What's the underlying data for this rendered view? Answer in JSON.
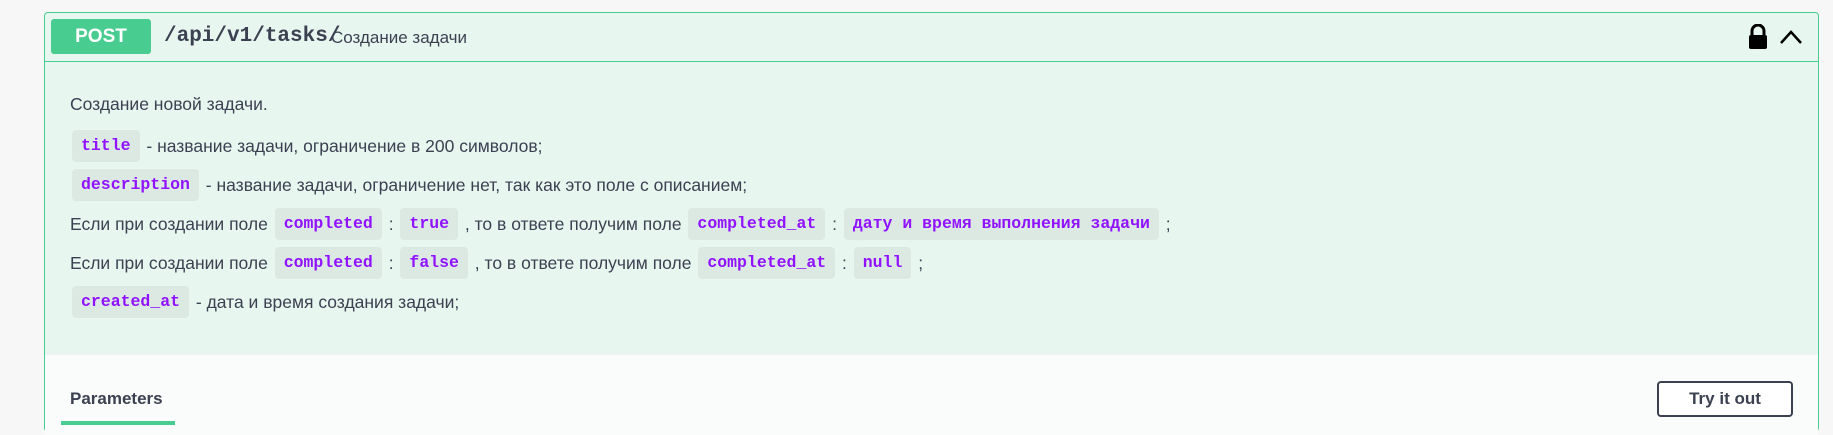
{
  "operation": {
    "method": "POST",
    "path": "/api/v1/tasks/",
    "summary": "Создание задачи"
  },
  "icons": {
    "lock": "lock-icon",
    "collapse": "chevron-up-icon"
  },
  "description": {
    "intro": "Создание новой задачи.",
    "title_line": {
      "code": "title",
      "text": " - название задачи, ограничение в 200 символов;"
    },
    "description_line": {
      "code": "description",
      "text": " - название задачи, ограничение нет, так как это поле с описанием;"
    },
    "completed_true_line": {
      "prefix": "Если при создании поле ",
      "field": "completed",
      "colon": " : ",
      "value": "true",
      "middle": " , то в ответе получим поле ",
      "result_field": "completed_at",
      "colon2": " : ",
      "result_value": "дату и время выполнения задачи",
      "suffix": " ;"
    },
    "completed_false_line": {
      "prefix": "Если при создании поле ",
      "field": "completed",
      "colon": " : ",
      "value": "false",
      "middle": " , то в ответе получим поле ",
      "result_field": "completed_at",
      "colon2": " : ",
      "result_value": "null",
      "suffix": " ;"
    },
    "created_at_line": {
      "code": "created_at",
      "text": " - дата и время создания задачи;"
    }
  },
  "parameters": {
    "tab_label": "Parameters",
    "try_button_label": "Try it out"
  },
  "colors": {
    "post_green": "#49cc90",
    "block_background": "#e8f6f0",
    "code_purple": "#9012fe",
    "text_dark": "#3b4151"
  }
}
